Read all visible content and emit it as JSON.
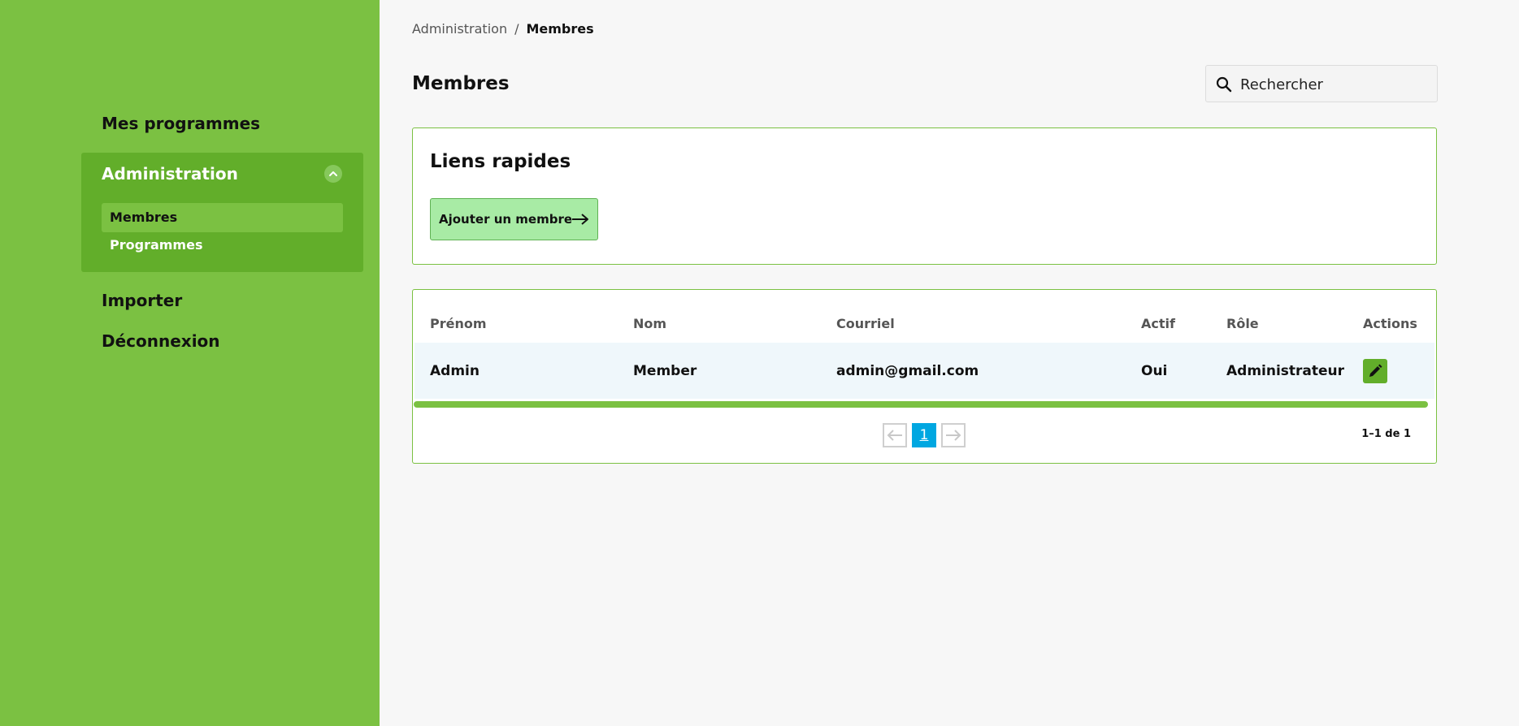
{
  "sidebar": {
    "items_top": [
      {
        "label": "Mes programmes"
      }
    ],
    "admin_group": {
      "label": "Administration",
      "children": [
        {
          "label": "Membres",
          "active": true
        },
        {
          "label": "Programmes",
          "active": false
        }
      ]
    },
    "items_bottom": [
      {
        "label": "Importer"
      },
      {
        "label": "Déconnexion"
      }
    ],
    "icons": {
      "toggle": "chevron-up-icon"
    }
  },
  "breadcrumb": {
    "parent": "Administration",
    "separator": "/",
    "current": "Membres"
  },
  "page": {
    "title": "Membres"
  },
  "search": {
    "placeholder": "Rechercher",
    "value": "",
    "icon": "search-icon"
  },
  "quick_links": {
    "title": "Liens rapides",
    "add_member_label": "Ajouter un membre",
    "icon": "arrow-right-icon"
  },
  "table": {
    "columns": [
      "Prénom",
      "Nom",
      "Courriel",
      "Actif",
      "Rôle",
      "Actions"
    ],
    "rows": [
      {
        "prenom": "Admin",
        "nom": "Member",
        "courriel": "admin@gmail.com",
        "actif": "Oui",
        "role": "Administrateur",
        "action_icon": "pencil-icon"
      }
    ]
  },
  "pagination": {
    "current_page": "1",
    "range_text": "1–1 de 1"
  },
  "colors": {
    "sidebar": "#7bc142",
    "sidebar_group": "#62ae2a",
    "accent_blue": "#00a7e1",
    "add_button": "#a8eba5",
    "row_highlight": "#eff7fb"
  }
}
